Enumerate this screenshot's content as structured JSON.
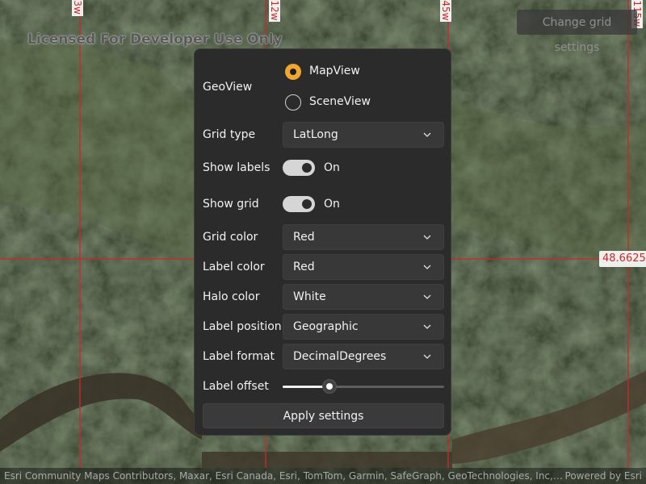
{
  "map": {
    "watermark": "Licensed For Developer Use Only",
    "grid_label_right": "48.6625",
    "grid_labels_top": [
      "-3w",
      "-12w",
      "-45w",
      "-115w"
    ],
    "grid_color": "#c62b2b"
  },
  "header": {
    "change_grid_button": "Change grid settings"
  },
  "settings": {
    "geoview": {
      "label": "GeoView",
      "options": [
        {
          "label": "MapView",
          "selected": true
        },
        {
          "label": "SceneView",
          "selected": false
        }
      ]
    },
    "grid_type": {
      "label": "Grid type",
      "value": "LatLong"
    },
    "show_labels": {
      "label": "Show labels",
      "state": "On"
    },
    "show_grid": {
      "label": "Show grid",
      "state": "On"
    },
    "grid_color": {
      "label": "Grid color",
      "value": "Red"
    },
    "label_color": {
      "label": "Label color",
      "value": "Red"
    },
    "halo_color": {
      "label": "Halo color",
      "value": "White"
    },
    "label_position": {
      "label": "Label position",
      "value": "Geographic"
    },
    "label_format": {
      "label": "Label format",
      "value": "DecimalDegrees"
    },
    "label_offset": {
      "label": "Label offset",
      "fraction": 0.29
    },
    "apply_button": "Apply settings"
  },
  "attribution": {
    "sources": "Esri Community Maps Contributors, Maxar, Esri Canada, Esri, TomTom, Garmin, SafeGraph, GeoTechnologies, Inc, METI/NASA, USGS",
    "powered_by": "Powered by Esri"
  },
  "colors": {
    "accent": "#f0a630",
    "panel_bg": "#2b2b2b"
  }
}
